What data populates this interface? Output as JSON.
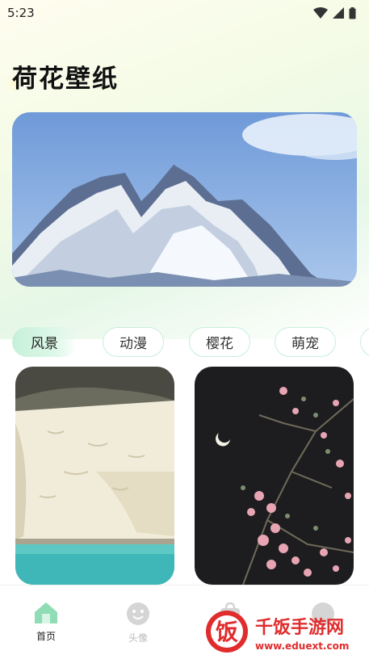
{
  "status": {
    "time": "5:23"
  },
  "page": {
    "title": "荷花壁纸"
  },
  "categories": [
    {
      "label": "风景",
      "active": true
    },
    {
      "label": "动漫",
      "active": false
    },
    {
      "label": "樱花",
      "active": false
    },
    {
      "label": "萌宠",
      "active": false
    }
  ],
  "nav": [
    {
      "label": "首页",
      "icon": "home-icon",
      "active": true
    },
    {
      "label": "头像",
      "icon": "smiley-icon",
      "active": false
    },
    {
      "label": "",
      "icon": "bag-icon",
      "active": false
    },
    {
      "label": "",
      "icon": "profile-icon",
      "active": false
    }
  ],
  "watermark": {
    "brand": "千饭手游网",
    "url": "www.eduext.com",
    "glyph": "饭"
  },
  "colors": {
    "accent": "#5fcf9b",
    "tab_border": "#c7eedc",
    "watermark_red": "#e02c2c"
  }
}
